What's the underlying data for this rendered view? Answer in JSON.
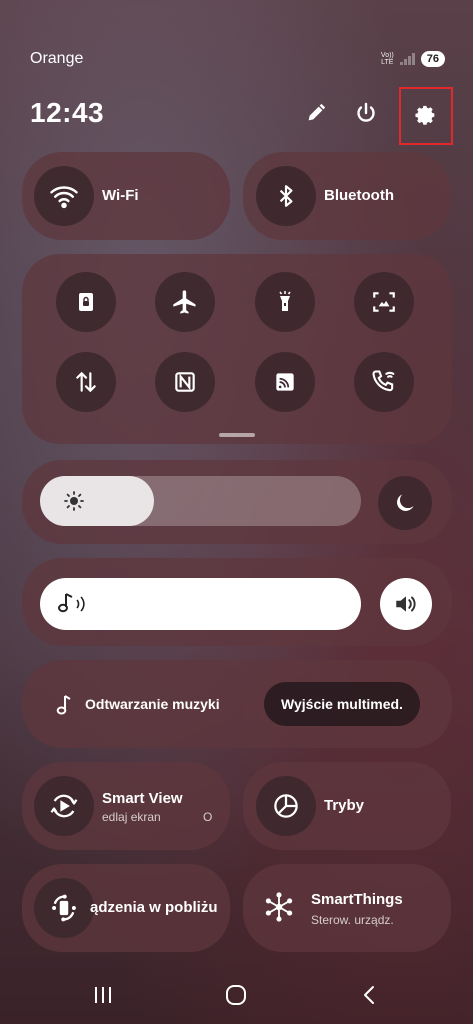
{
  "status_bar": {
    "carrier": "Orange",
    "volte_top": "Vo))",
    "volte_bottom": "LTE",
    "battery": "76"
  },
  "header": {
    "time": "12:43",
    "icons": [
      "pencil-icon",
      "power-icon",
      "gear-icon"
    ]
  },
  "tiles_top": [
    {
      "label": "Wi-Fi",
      "icon": "wifi-icon"
    },
    {
      "label": "Bluetooth",
      "icon": "bluetooth-icon"
    }
  ],
  "grid_icons": [
    "secure-folder-icon",
    "airplane-icon",
    "flashlight-icon",
    "screenshot-icon",
    "mobile-data-icon",
    "nfc-icon",
    "cast-icon",
    "wifi-calling-icon"
  ],
  "brightness": {
    "icon": "sun-icon",
    "level": 0.3
  },
  "dark_mode": {
    "icon": "moon-icon"
  },
  "volume": {
    "icon": "music-note-sound-icon"
  },
  "sound_mode": {
    "icon": "speaker-icon"
  },
  "media": {
    "playback_label": "Odtwarzanie muzyki",
    "output_label": "Wyjście multimed."
  },
  "tiles_bottom": [
    {
      "label": "Smart View",
      "sub": "edlaj ekran",
      "sub_extra": "O",
      "icon": "smart-view-icon"
    },
    {
      "label": "Tryby",
      "sub": "",
      "icon": "modes-icon"
    },
    {
      "label": "ądzenia w pobliżu",
      "sub": "",
      "icon": "nearby-devices-icon"
    },
    {
      "label": "SmartThings",
      "sub": "Sterow. urządz.",
      "icon": "smartthings-icon"
    }
  ],
  "navbar": {
    "icons": [
      "recents-icon",
      "home-icon",
      "back-icon"
    ]
  },
  "colors": {
    "accent_highlight": "#e0282d",
    "panel": "#5f373e",
    "track": "#ffffff"
  }
}
